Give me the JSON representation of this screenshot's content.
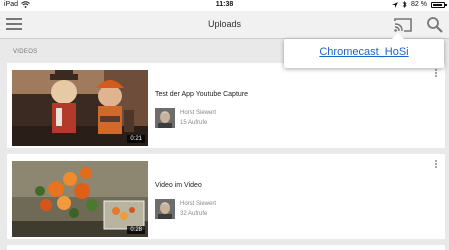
{
  "status_bar": {
    "device": "iPad",
    "time": "11:38",
    "battery": "82 %"
  },
  "app_bar": {
    "title": "Uploads"
  },
  "cast_popup": {
    "device_name": "Chromecast_HoSi"
  },
  "section": {
    "label": "VIDEOS"
  },
  "videos": [
    {
      "title": "Test der App Youtube Capture",
      "channel": "Horst Siewert",
      "views": "15 Aufrufe",
      "duration": "0:21"
    },
    {
      "title": "Video im Video",
      "channel": "Horst Siewert",
      "views": "32 Aufrufe",
      "duration": "0:28"
    }
  ],
  "colors": {
    "link_blue": "#1a66c9",
    "background": "#e9e9e9",
    "app_bar": "#f1f1f1"
  }
}
